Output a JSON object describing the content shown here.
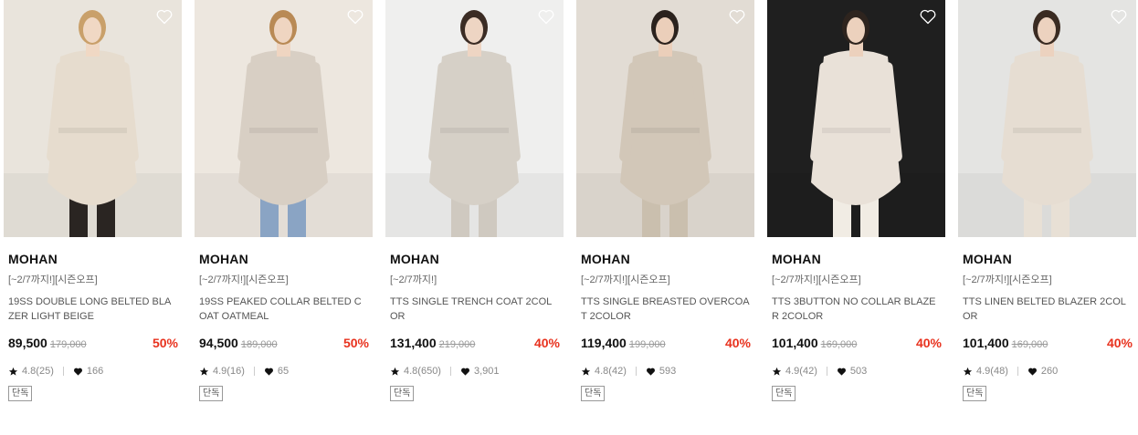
{
  "accent_color": "#e8321e",
  "products": [
    {
      "brand": "MOHAN",
      "promo": "[~2/7까지!][시즌오프]",
      "name": "19SS DOUBLE LONG BELTED BLAZER LIGHT BEIGE",
      "price": "89,500",
      "original_price": "179,000",
      "discount": "50%",
      "rating": "4.8(25)",
      "likes": "166",
      "tag": "단독",
      "image": {
        "bg": "#e9e4dc",
        "garment": "#e6dcce",
        "pants": "#2a2522",
        "hair": "#c9a06a",
        "skin": "#f0d8c4"
      }
    },
    {
      "brand": "MOHAN",
      "promo": "[~2/7까지!][시즌오프]",
      "name": "19SS PEAKED COLLAR BELTED COAT OATMEAL",
      "price": "94,500",
      "original_price": "189,000",
      "discount": "50%",
      "rating": "4.9(16)",
      "likes": "65",
      "tag": "단독",
      "image": {
        "bg": "#ede7df",
        "garment": "#d8cfc4",
        "pants": "#8aa4c4",
        "hair": "#b98a55",
        "skin": "#efd5c1"
      }
    },
    {
      "brand": "MOHAN",
      "promo": "[~2/7까지!]",
      "name": "TTS SINGLE TRENCH COAT 2COLOR",
      "price": "131,400",
      "original_price": "219,000",
      "discount": "40%",
      "rating": "4.8(650)",
      "likes": "3,901",
      "tag": "단독",
      "image": {
        "bg": "#efefee",
        "garment": "#d6d0c7",
        "pants": "#cfc9c0",
        "hair": "#3b2c24",
        "skin": "#eed5c3"
      }
    },
    {
      "brand": "MOHAN",
      "promo": "[~2/7까지!][시즌오프]",
      "name": "TTS SINGLE BREASTED OVERCOAT 2COLOR",
      "price": "119,400",
      "original_price": "199,000",
      "discount": "40%",
      "rating": "4.8(42)",
      "likes": "593",
      "tag": "단독",
      "image": {
        "bg": "#e2dcd4",
        "garment": "#d2c7b8",
        "pants": "#cabfae",
        "hair": "#2b221d",
        "skin": "#ebcfba"
      }
    },
    {
      "brand": "MOHAN",
      "promo": "[~2/7까지!][시즌오프]",
      "name": "TTS 3BUTTON NO COLLAR BLAZER 2COLOR",
      "price": "101,400",
      "original_price": "169,000",
      "discount": "40%",
      "rating": "4.9(42)",
      "likes": "503",
      "tag": "단독",
      "image": {
        "bg": "#1f1f1f",
        "garment": "#e9e1d8",
        "pants": "#f1ece4",
        "hair": "#2e241e",
        "skin": "#ecd1bd"
      }
    },
    {
      "brand": "MOHAN",
      "promo": "[~2/7까지!][시즌오프]",
      "name": "TTS LINEN BELTED BLAZER 2COLOR",
      "price": "101,400",
      "original_price": "169,000",
      "discount": "40%",
      "rating": "4.9(48)",
      "likes": "260",
      "tag": "단독",
      "image": {
        "bg": "#e4e4e2",
        "garment": "#e6ddd2",
        "pants": "#e8e0d5",
        "hair": "#3a2b22",
        "skin": "#ecd2bf"
      }
    }
  ]
}
